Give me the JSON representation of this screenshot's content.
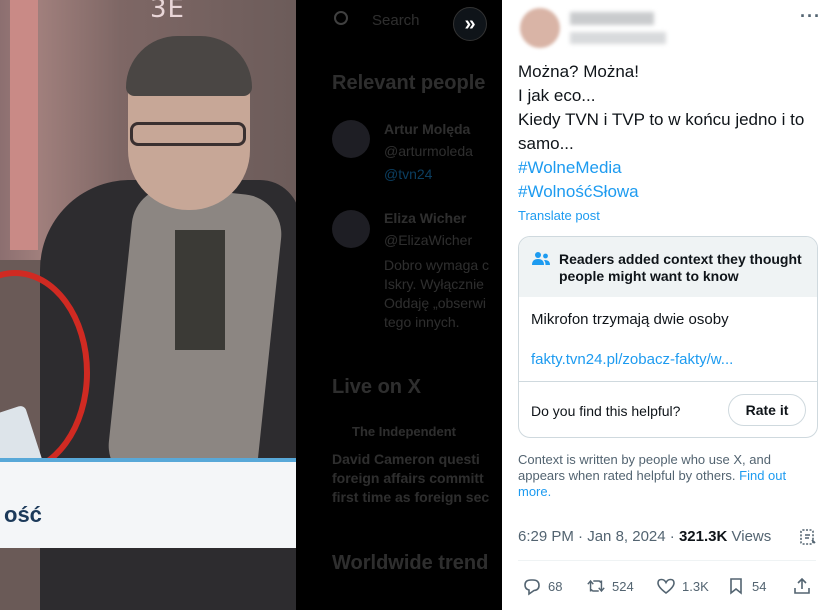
{
  "background": {
    "sign_text": "3E",
    "lower_third_text": "ość",
    "search_placeholder": "Search",
    "relevant_people_heading": "Relevant people",
    "people": [
      {
        "name": "Artur Molęda",
        "handle": "@arturmoleda",
        "link": "@tvn24"
      },
      {
        "name": "Eliza Wicher",
        "handle": "@ElizaWicher",
        "bio": [
          "Dobro wymaga c",
          "Iskry. Wyłącznie",
          "Oddaję „obserwi",
          "tego innych."
        ]
      }
    ],
    "live_heading": "Live on X",
    "live_source": "The Independent",
    "live_headline": [
      "David Cameron questi",
      "foreign affairs committ",
      "first time as foreign sec"
    ],
    "trends_heading": "Worldwide trend"
  },
  "tweet": {
    "text_lines": [
      "Można? Można!",
      "I jak eco...",
      "Kiedy TVN i TVP to w końcu jedno i to",
      "samo..."
    ],
    "hashtags": [
      "#WolneMedia",
      "#WolnośćSłowa"
    ],
    "translate_label": "Translate post",
    "more_label": "···"
  },
  "community_note": {
    "header": "Readers added context they thought people might want to know",
    "body": "Mikrofon trzymają dwie osoby",
    "link": "fakty.tvn24.pl/zobacz-fakty/w...",
    "helpful_question": "Do you find this helpful?",
    "rate_button": "Rate it",
    "footer": "Context is written by people who use X, and appears when rated helpful by others.",
    "footer_link": "Find out more."
  },
  "meta": {
    "time": "6:29 PM",
    "dot": " · ",
    "date": "Jan 8, 2024",
    "views_count": "321.3K",
    "views_label": " Views"
  },
  "actions": {
    "replies": "68",
    "reposts": "524",
    "likes": "1.3K",
    "bookmarks": "54"
  },
  "colors": {
    "link": "#1d9bf0",
    "secondary_text": "#536471",
    "note_header_bg": "#eff3f4",
    "border": "#cfd9de"
  }
}
